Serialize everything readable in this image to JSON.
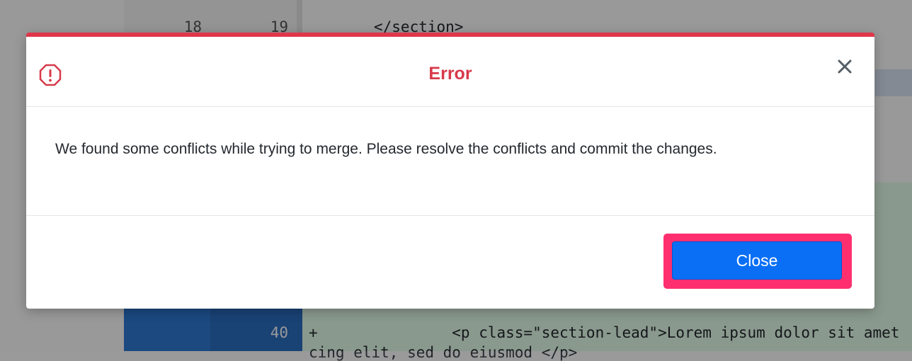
{
  "background": {
    "top_line": {
      "old_no": "18",
      "new_no": "19",
      "code": "</section>"
    },
    "bottom_line": {
      "new_no": "40",
      "code": "+               <p class=\"section-lead\">Lorem ipsum dolor sit amet"
    },
    "bottom_line_wrap": "cing elit, sed do eiusmod </p>"
  },
  "dialog": {
    "title": "Error",
    "message": "We found some conflicts while trying to merge. Please resolve the conflicts and commit the changes.",
    "close_button_label": "Close",
    "accent_color": "#d73a49",
    "button_color": "#0a6ff5",
    "highlight_color": "#ff2f6f",
    "icons": {
      "status": "error-octagon-icon",
      "dismiss": "close-icon"
    }
  }
}
